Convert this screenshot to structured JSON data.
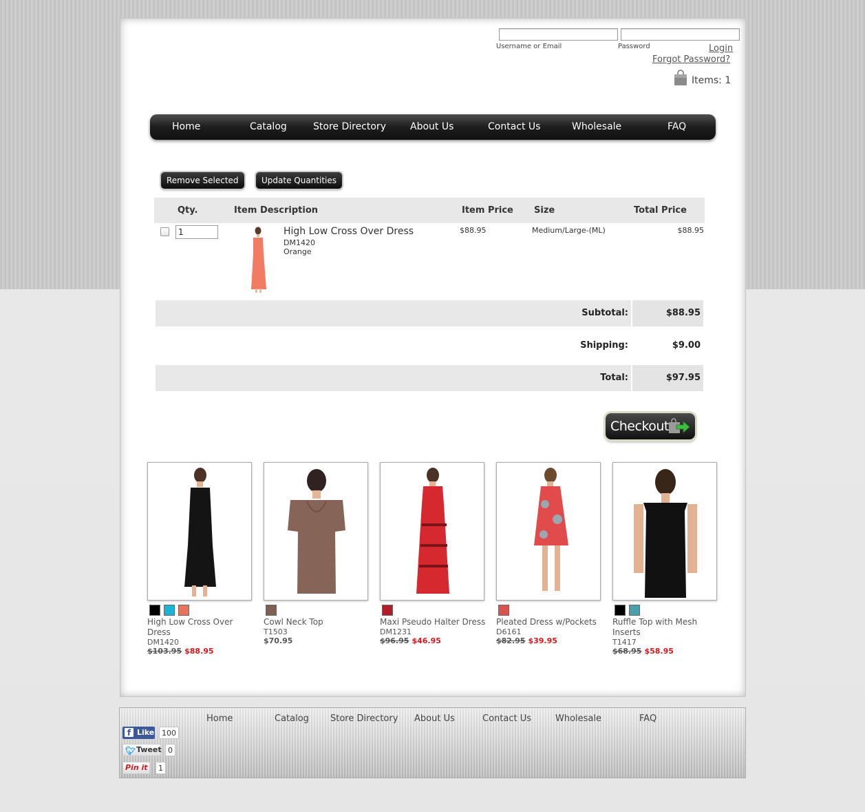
{
  "login": {
    "username_label": "Username or Email",
    "password_label": "Password",
    "login_link": "Login",
    "forgot_link": "Forgot Password?"
  },
  "cart_summary": {
    "items_label": "Items: 1"
  },
  "nav": {
    "items": [
      "Home",
      "Catalog",
      "Store Directory",
      "About Us",
      "Contact Us",
      "Wholesale",
      "FAQ"
    ]
  },
  "cart_actions": {
    "remove_label": "Remove Selected",
    "update_label": "Update Quantities"
  },
  "cart_table": {
    "headers": {
      "qty": "Qty.",
      "description": "Item Description",
      "item_price": "Item Price",
      "size": "Size",
      "total_price": "Total Price"
    },
    "rows": [
      {
        "qty": "1",
        "name": "High Low Cross Over Dress",
        "sku": "DM1420",
        "color": "Orange",
        "item_price": "$88.95",
        "size": "Medium/Large-(ML)",
        "total_price": "$88.95"
      }
    ]
  },
  "totals": {
    "subtotal_label": "Subtotal:",
    "subtotal": "$88.95",
    "shipping_label": "Shipping:",
    "shipping": "$9.00",
    "total_label": "Total:",
    "total": "$97.95"
  },
  "checkout": {
    "label": "Checkout"
  },
  "products": [
    {
      "name": "High Low Cross Over Dress",
      "sku": "DM1420",
      "old_price": "$103.95",
      "price": "$88.95",
      "swatches": [
        "#000000",
        "#1bb3d6",
        "#e8735c"
      ]
    },
    {
      "name": "Cowl Neck Top",
      "sku": "T1503",
      "old_price": "",
      "price": "$70.95",
      "swatches": [
        "#7f5f52"
      ]
    },
    {
      "name": "Maxi Pseudo Halter Dress",
      "sku": "DM1231",
      "old_price": "$96.95",
      "price": "$46.95",
      "swatches": [
        "#b01e2c"
      ]
    },
    {
      "name": "Pleated Dress w/Pockets",
      "sku": "D6161",
      "old_price": "$82.95",
      "price": "$39.95",
      "swatches": [
        "#d9534f"
      ]
    },
    {
      "name": "Ruffle Top with Mesh Inserts",
      "sku": "T1417",
      "old_price": "$68.95",
      "price": "$58.95",
      "swatches": [
        "#000000",
        "#4aa0aa"
      ]
    }
  ],
  "footer": {
    "nav": [
      "Home",
      "Catalog",
      "Store Directory",
      "About Us",
      "Contact Us",
      "Wholesale",
      "FAQ"
    ],
    "social": {
      "like_label": "Like",
      "like_count": "100",
      "tweet_label": "Tweet",
      "tweet_count": "0",
      "pin_label": "Pin it",
      "pin_count": "1"
    }
  },
  "colors": {
    "accent_red": "#d7191c",
    "facebook": "#3b5998",
    "twitter": "#1da1f2",
    "pinterest": "#cb2027"
  }
}
